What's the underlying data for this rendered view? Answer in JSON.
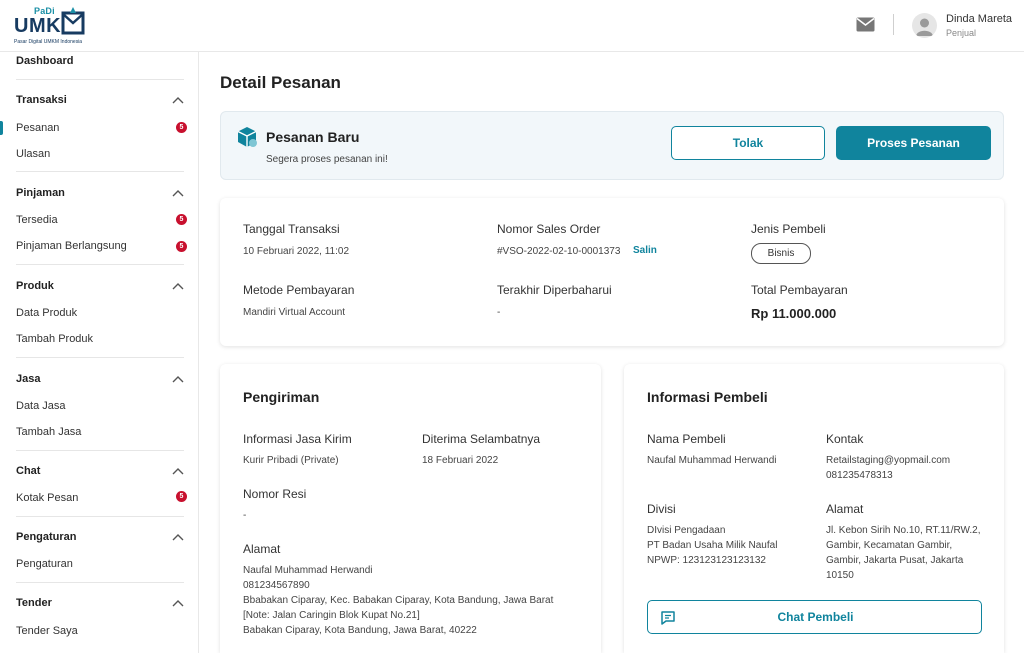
{
  "header": {
    "logo": {
      "padi": "PaDi",
      "umk": "UMK",
      "tagline": "Pasar Digital UMKM Indonesia"
    },
    "user_name": "Dinda Mareta",
    "user_role": "Penjual",
    "icons": {
      "mail": "mail-icon",
      "avatar": "avatar-icon"
    }
  },
  "sidebar": {
    "dashboard": "Dashboard",
    "sections": [
      {
        "title": "Transaksi",
        "items": [
          {
            "label": "Pesanan",
            "badge": "5"
          },
          {
            "label": "Ulasan"
          }
        ]
      },
      {
        "title": "Pinjaman",
        "items": [
          {
            "label": "Tersedia",
            "badge": "5"
          },
          {
            "label": "Pinjaman Berlangsung",
            "badge": "5"
          }
        ]
      },
      {
        "title": "Produk",
        "items": [
          {
            "label": "Data Produk"
          },
          {
            "label": "Tambah Produk"
          }
        ]
      },
      {
        "title": "Jasa",
        "items": [
          {
            "label": "Data Jasa"
          },
          {
            "label": "Tambah Jasa"
          }
        ]
      },
      {
        "title": "Chat",
        "items": [
          {
            "label": "Kotak Pesan",
            "badge": "5"
          }
        ]
      },
      {
        "title": "Pengaturan",
        "items": [
          {
            "label": "Pengaturan"
          }
        ]
      },
      {
        "title": "Tender",
        "items": [
          {
            "label": "Tender Saya"
          }
        ]
      }
    ],
    "active_item": "Pesanan"
  },
  "main": {
    "title": "Detail Pesanan",
    "banner": {
      "title": "Pesanan Baru",
      "subtitle": "Segera proses pesanan ini!",
      "reject_label": "Tolak",
      "process_label": "Proses Pesanan"
    },
    "summary": {
      "tanggal_label": "Tanggal Transaksi",
      "tanggal_value": "10 Februari 2022, 11:02",
      "so_label": "Nomor Sales Order",
      "so_value": "#VSO-2022-02-10-0001373",
      "copy_label": "Salin",
      "jenis_label": "Jenis Pembeli",
      "jenis_value": "Bisnis",
      "metode_label": "Metode Pembayaran",
      "metode_value": "Mandiri Virtual Account",
      "update_label": "Terakhir Diperbaharui",
      "update_value": "-",
      "total_label": "Total Pembayaran",
      "total_value": "Rp 11.000.000"
    },
    "pengiriman": {
      "title": "Pengiriman",
      "jasa_label": "Informasi Jasa Kirim",
      "jasa_value": "Kurir Pribadi (Private)",
      "diterima_label": "Diterima Selambatnya",
      "diterima_value": "18 Februari 2022",
      "resi_label": "Nomor Resi",
      "resi_value": "-",
      "alamat_label": "Alamat",
      "alamat_lines": [
        "Naufal Muhammad Herwandi",
        "081234567890",
        "Bbabakan Ciparay, Kec. Babakan Ciparay, Kota Bandung, Jawa Barat",
        "[Note: Jalan Caringin Blok Kupat No.21]",
        "Babakan Ciparay, Kota Bandung, Jawa Barat, 40222"
      ]
    },
    "pembeli": {
      "title": "Informasi Pembeli",
      "nama_label": "Nama Pembeli",
      "nama_value": "Naufal Muhammad Herwandi",
      "kontak_label": "Kontak",
      "kontak_lines": [
        "Retailstaging@yopmail.com",
        "081235478313"
      ],
      "divisi_label": "Divisi",
      "divisi_lines": [
        "DIvisi Pengadaan",
        "PT Badan Usaha Milik Naufal",
        "NPWP: 123123123123132"
      ],
      "alamat_label": "Alamat",
      "alamat_lines": [
        "Jl. Kebon Sirih No.10, RT.11/RW.2,",
        "Gambir, Kecamatan Gambir,",
        "Gambir, Jakarta Pusat, Jakarta",
        "10150"
      ],
      "chat_label": "Chat Pembeli"
    }
  },
  "colors": {
    "accent": "#10849d",
    "badge": "#c8102e",
    "brand_dark": "#173b61"
  }
}
